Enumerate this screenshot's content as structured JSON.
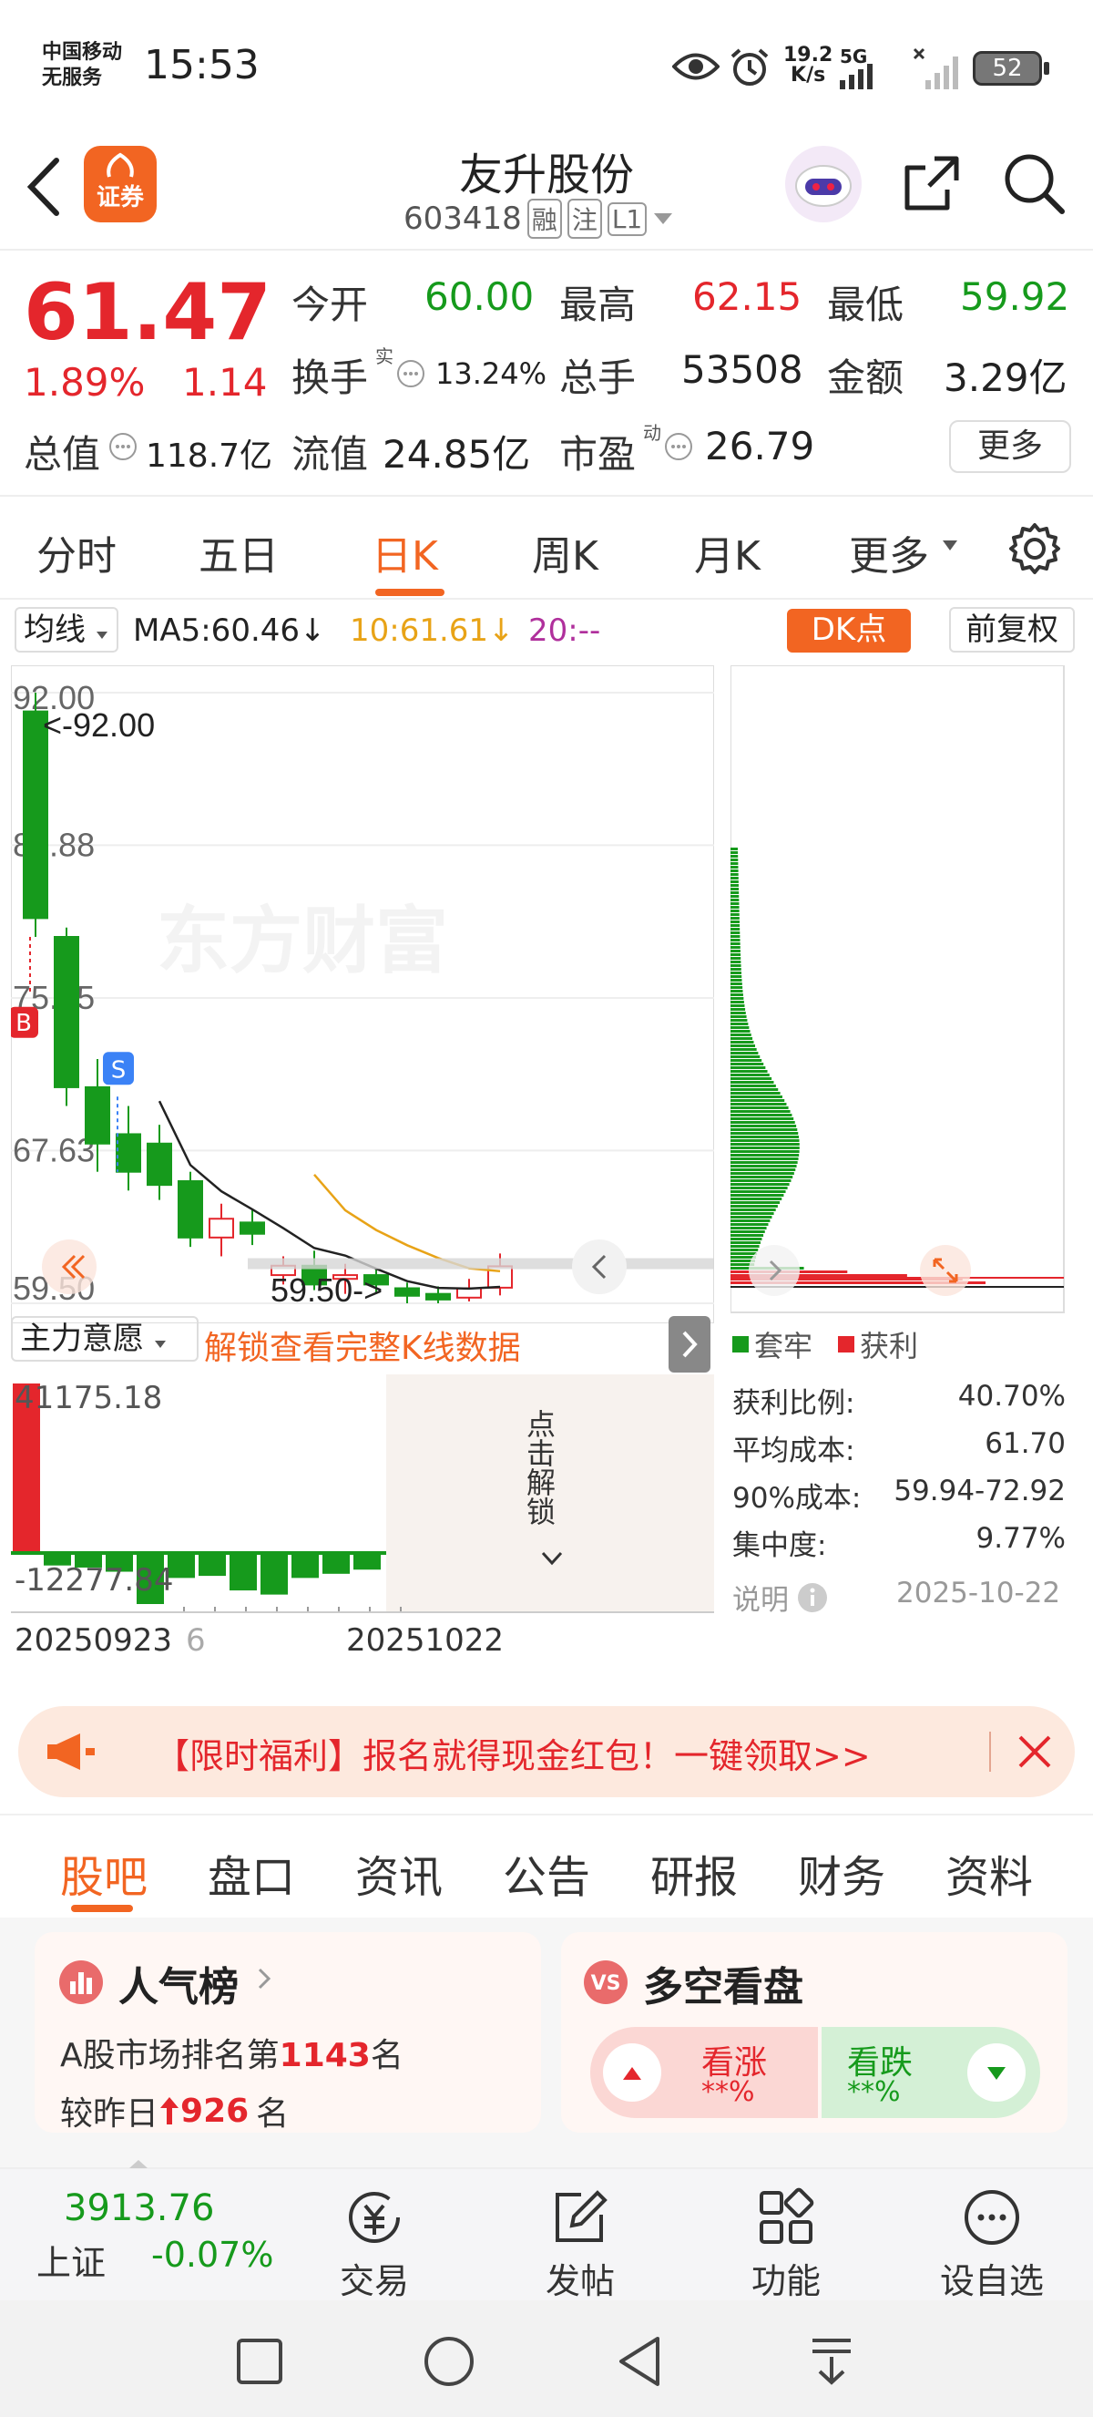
{
  "status_bar": {
    "carrier": "中国移动",
    "carrier_sub": "无服务",
    "time": "15:53",
    "net_speed": "19.2",
    "net_unit": "K/s",
    "net_type": "5G",
    "battery": "52"
  },
  "header": {
    "app_badge": "证券",
    "stock_name": "友升股份",
    "stock_code": "603418",
    "tags": [
      "融",
      "注",
      "L1"
    ]
  },
  "quote": {
    "price": "61.47",
    "change_pct": "1.89%",
    "change_amt": "1.14",
    "open_label": "今开",
    "open": "60.00",
    "high_label": "最高",
    "high": "62.15",
    "low_label": "最低",
    "low": "59.92",
    "turnover_label": "换手",
    "turnover_sup": "实",
    "turnover": "13.24%",
    "volume_label": "总手",
    "volume": "53508",
    "amount_label": "金额",
    "amount": "3.29亿",
    "mktcap_label": "总值",
    "mktcap": "118.7亿",
    "float_label": "流值",
    "float_cap": "24.85亿",
    "pe_label": "市盈",
    "pe_sup": "动",
    "pe": "26.79",
    "more_button": "更多"
  },
  "period_tabs": [
    "分时",
    "五日",
    "日K",
    "周K",
    "月K",
    "更多"
  ],
  "active_period": "日K",
  "indicator": {
    "selector": "均线",
    "ma5": "MA5:60.46↓",
    "ma10": "10:61.61↓",
    "ma20": "20:--",
    "dk_button": "DK点",
    "adjust_button": "前复权",
    "ma5_color": "#222222",
    "ma10_color": "#e8a317",
    "ma20_color": "#b0309c"
  },
  "kline": {
    "y_ticks": [
      "92.00",
      "83.88",
      "75.75",
      "67.63",
      "59.50"
    ],
    "max_note": "<-92.00",
    "min_note": "59.50->",
    "buy_marker": "B",
    "sell_marker": "S",
    "watermark": "东方财富"
  },
  "chart_data": {
    "type": "candlestick",
    "ylim": [
      59.5,
      92.0
    ],
    "candles": [
      {
        "o": 91.0,
        "c": 80.0,
        "h": 92.0,
        "l": 79.0
      },
      {
        "o": 79.0,
        "c": 71.0,
        "h": 79.5,
        "l": 70.0
      },
      {
        "o": 71.0,
        "c": 68.0,
        "h": 72.5,
        "l": 66.5
      },
      {
        "o": 68.5,
        "c": 66.5,
        "h": 70.0,
        "l": 65.5
      },
      {
        "o": 68.0,
        "c": 65.8,
        "h": 69.0,
        "l": 65.0
      },
      {
        "o": 66.0,
        "c": 63.0,
        "h": 66.5,
        "l": 62.5
      },
      {
        "o": 63.0,
        "c": 64.0,
        "h": 64.8,
        "l": 62.0
      },
      {
        "o": 63.8,
        "c": 63.2,
        "h": 64.5,
        "l": 62.6
      },
      {
        "o": 61.0,
        "c": 61.5,
        "h": 62.0,
        "l": 60.5
      },
      {
        "o": 61.5,
        "c": 60.5,
        "h": 62.3,
        "l": 60.2
      },
      {
        "o": 60.8,
        "c": 61.0,
        "h": 61.6,
        "l": 60.0
      },
      {
        "o": 61.0,
        "c": 60.5,
        "h": 61.3,
        "l": 60.0
      },
      {
        "o": 60.3,
        "c": 59.9,
        "h": 60.6,
        "l": 59.5
      },
      {
        "o": 60.0,
        "c": 59.7,
        "h": 60.4,
        "l": 59.5
      },
      {
        "o": 59.8,
        "c": 60.3,
        "h": 60.8,
        "l": 59.6
      },
      {
        "o": 60.33,
        "c": 61.47,
        "h": 62.15,
        "l": 59.92
      }
    ]
  },
  "main_force": {
    "selector": "主力意愿",
    "unlock_link": "解锁查看完整K线数据",
    "top_value": "41175.18",
    "bottom_value": "-12277.84",
    "unlock_vertical": "点击解锁",
    "date_start": "20250923",
    "date_start_partial": "6",
    "date_end": "20251022",
    "bars": [
      41175,
      -3000,
      -3500,
      -4500,
      -12277,
      -6000,
      -5500,
      -9000,
      -10000,
      -6000,
      -5000,
      -4000
    ]
  },
  "chip": {
    "legend_trapped": "套牢",
    "legend_profit": "获利",
    "rows": [
      {
        "label": "获利比例:",
        "value": "40.70%"
      },
      {
        "label": "平均成本:",
        "value": "61.70"
      },
      {
        "label": "90%成本:",
        "value": "59.94-72.92"
      },
      {
        "label": "集中度:",
        "value": "9.77%"
      }
    ],
    "note_label": "说明",
    "date": "2025-10-22"
  },
  "banner": {
    "text": "【限时福利】报名就得现金红包！一键领取>>"
  },
  "bottom_tabs": [
    "股吧",
    "盘口",
    "资讯",
    "公告",
    "研报",
    "财务",
    "资料"
  ],
  "active_bottom_tab": "股吧",
  "popularity": {
    "title": "人气榜",
    "line1_prefix": "A股市场排名第",
    "rank": "1143",
    "line1_suffix": "名",
    "line2_prefix": "较昨日",
    "delta": "926",
    "line2_suffix": "名"
  },
  "long_short": {
    "title": "多空看盘",
    "bull_label": "看涨",
    "bull_value": "**%",
    "bear_label": "看跌",
    "bear_value": "**%"
  },
  "toolbar": {
    "index_value": "3913.76",
    "index_name": "上证",
    "index_change": "-0.07%",
    "items": [
      "交易",
      "发帖",
      "功能",
      "设自选"
    ]
  },
  "colors": {
    "up": "#e4262c",
    "down": "#169a1c",
    "accent": "#f26522"
  }
}
